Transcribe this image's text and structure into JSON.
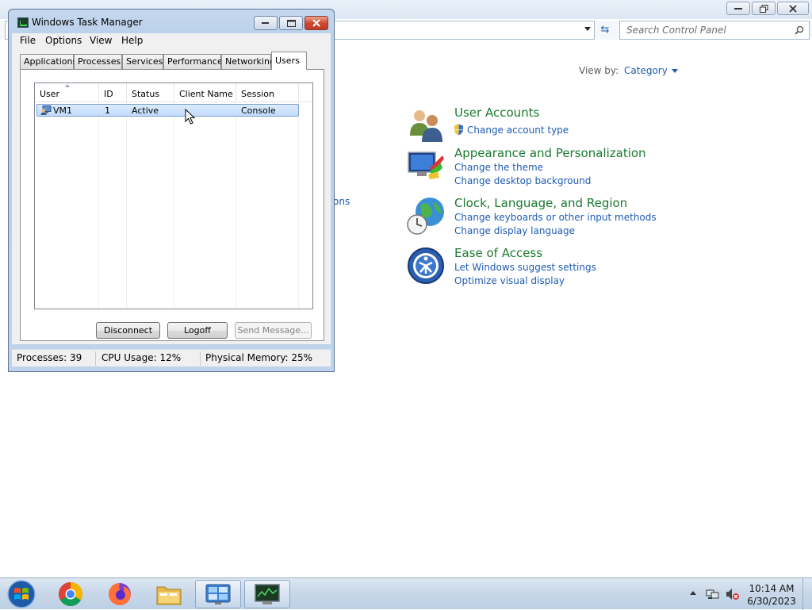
{
  "control_panel": {
    "search_placeholder": "Search Control Panel",
    "view_by_label": "View by:",
    "view_by_value": "Category",
    "partial_link": "ons",
    "categories": [
      {
        "title": "User Accounts",
        "links": [
          "Change account type"
        ]
      },
      {
        "title": "Appearance and Personalization",
        "links": [
          "Change the theme",
          "Change desktop background"
        ]
      },
      {
        "title": "Clock, Language, and Region",
        "links": [
          "Change keyboards or other input methods",
          "Change display language"
        ]
      },
      {
        "title": "Ease of Access",
        "links": [
          "Let Windows suggest settings",
          "Optimize visual display"
        ]
      }
    ]
  },
  "task_manager": {
    "title": "Windows Task Manager",
    "menu": [
      "File",
      "Options",
      "View",
      "Help"
    ],
    "tabs": [
      "Applications",
      "Processes",
      "Services",
      "Performance",
      "Networking",
      "Users"
    ],
    "active_tab": "Users",
    "columns": [
      "User",
      "ID",
      "Status",
      "Client Name",
      "Session"
    ],
    "rows": [
      {
        "user": "VM1",
        "id": "1",
        "status": "Active",
        "client_name": "",
        "session": "Console"
      }
    ],
    "buttons": {
      "disconnect": "Disconnect",
      "logoff": "Logoff",
      "send_message": "Send Message..."
    },
    "status": {
      "processes": "Processes: 39",
      "cpu": "CPU Usage: 12%",
      "memory": "Physical Memory: 25%"
    }
  },
  "taskbar": {
    "time": "10:14 AM",
    "date": "6/30/2023",
    "apps": [
      "chrome-icon",
      "firefox-icon",
      "file-explorer-icon",
      "control-panel-icon",
      "task-manager-icon"
    ]
  },
  "colors": {
    "category_title": "#1a7a2e",
    "link": "#1e5bb5",
    "selection": "#c1dcfc"
  }
}
